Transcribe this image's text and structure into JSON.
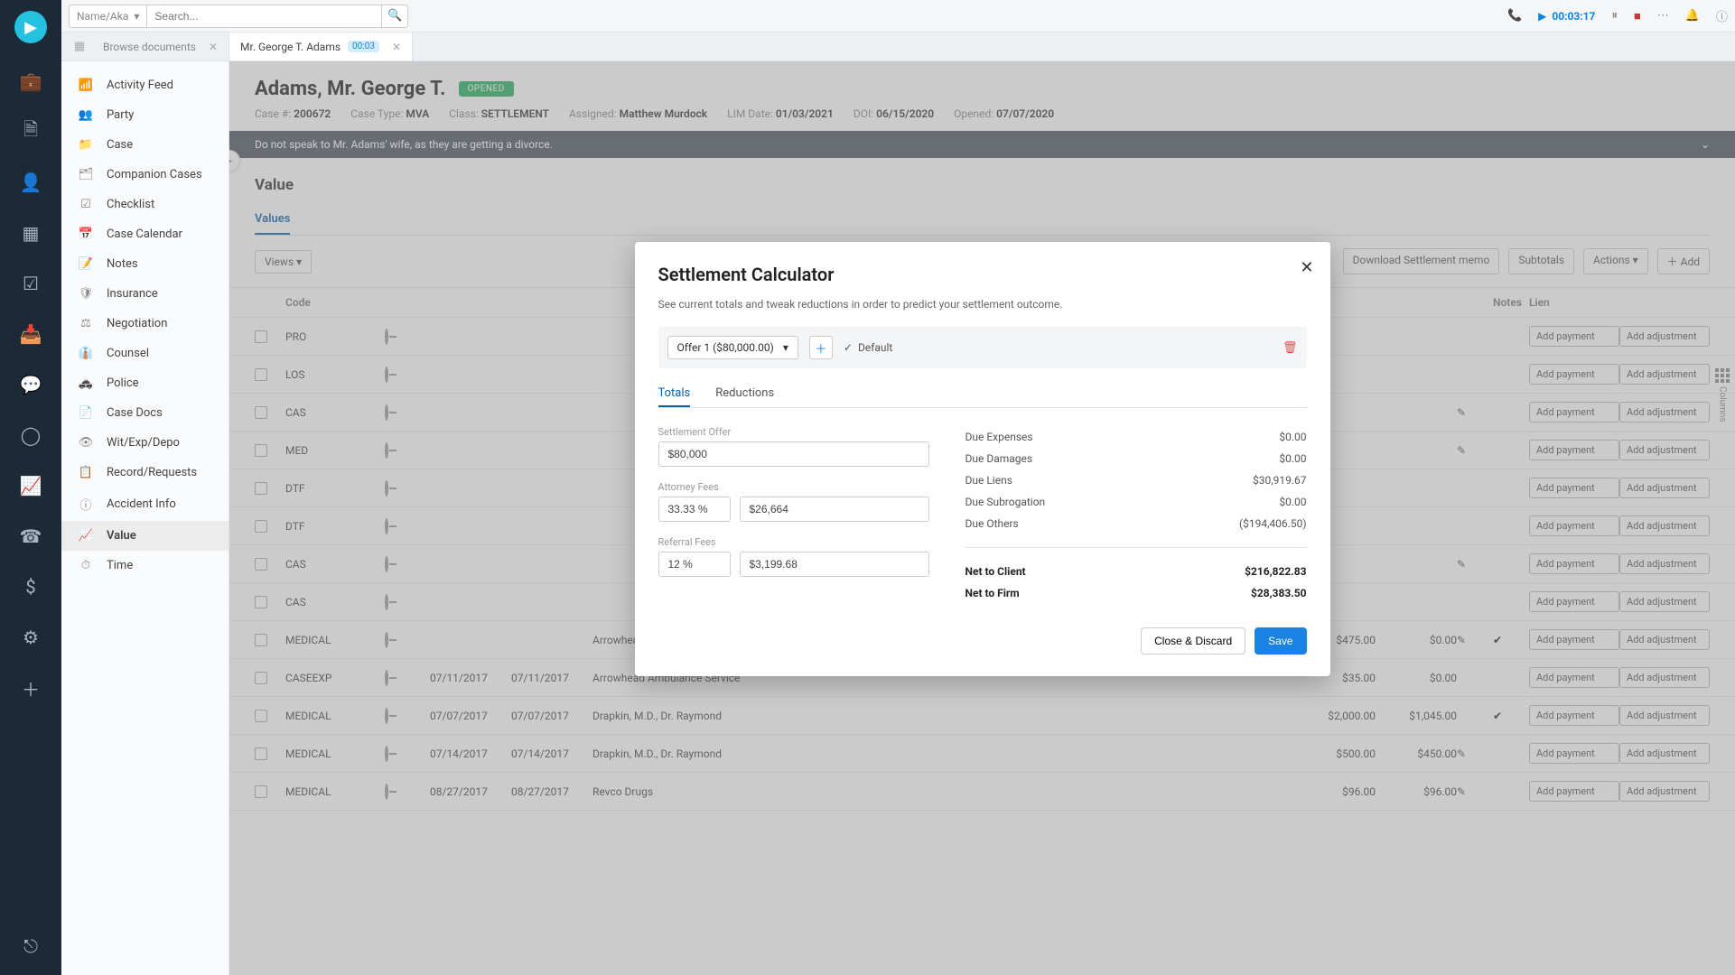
{
  "topbar": {
    "name_kind": "Name/Aka",
    "search_placeholder": "Search...",
    "timer": "00:03:17"
  },
  "tabs": {
    "browse": "Browse documents",
    "active": "Mr. George T. Adams",
    "active_badge": "00:03"
  },
  "sidenav": [
    "Activity Feed",
    "Party",
    "Case",
    "Companion Cases",
    "Checklist",
    "Case Calendar",
    "Notes",
    "Insurance",
    "Negotiation",
    "Counsel",
    "Police",
    "Case Docs",
    "Wit/Exp/Depo",
    "Record/Requests",
    "Accident Info",
    "Value",
    "Time"
  ],
  "case": {
    "name": "Adams, Mr. George T.",
    "status": "OPENED",
    "number_label": "Case #:",
    "number": "200672",
    "type_label": "Case Type:",
    "type": "MVA",
    "class_label": "Class:",
    "class": "SETTLEMENT",
    "assigned_label": "Assigned:",
    "assigned": "Matthew Murdock",
    "lim_label": "LIM Date:",
    "lim": "01/03/2021",
    "doi_label": "DOI:",
    "doi": "06/15/2020",
    "opened_label": "Opened:",
    "opened": "07/07/2020",
    "banner": "Do not speak to Mr. Adams' wife, as they are getting a divorce."
  },
  "value_section": {
    "title": "Value",
    "subtabs": [
      "Values"
    ],
    "toolbar": {
      "views": "Views",
      "dl": "Download Settlement memo",
      "subtotals": "Subtotals",
      "actions": "Actions",
      "add": "Add"
    },
    "headers": [
      "Code",
      "",
      "",
      "",
      "",
      "",
      "",
      "",
      "",
      "Notes",
      "Lien",
      "",
      ""
    ]
  },
  "rows": [
    {
      "code": "PRO",
      "d1": "",
      "d2": "",
      "payee": "",
      "amt": "",
      "amt2": "",
      "edit": false,
      "ck": false
    },
    {
      "code": "LOS",
      "d1": "",
      "d2": "",
      "payee": "",
      "amt": "",
      "amt2": "",
      "edit": false,
      "ck": false
    },
    {
      "code": "CAS",
      "d1": "",
      "d2": "",
      "payee": "",
      "amt": "",
      "amt2": "",
      "edit": true,
      "ck": false
    },
    {
      "code": "MED",
      "d1": "",
      "d2": "",
      "payee": "",
      "amt": "",
      "amt2": "",
      "edit": true,
      "ck": false
    },
    {
      "code": "DTF",
      "d1": "",
      "d2": "",
      "payee": "",
      "amt": "",
      "amt2": "",
      "edit": false,
      "ck": false
    },
    {
      "code": "DTF",
      "d1": "",
      "d2": "",
      "payee": "",
      "amt": "",
      "amt2": "",
      "edit": false,
      "ck": false
    },
    {
      "code": "CAS",
      "d1": "",
      "d2": "",
      "payee": "",
      "amt": "",
      "amt2": "",
      "edit": true,
      "ck": false
    },
    {
      "code": "CAS",
      "d1": "",
      "d2": "",
      "payee": "",
      "amt": "",
      "amt2": "",
      "edit": false,
      "ck": false
    },
    {
      "code": "MEDICAL",
      "d1": "",
      "d2": "",
      "payee": "Arrowhead Ambulance Service",
      "amt": "$475.00",
      "amt2": "$0.00",
      "edit": true,
      "ck": true
    },
    {
      "code": "CASEEXP",
      "d1": "07/11/2017",
      "d2": "07/11/2017",
      "payee": "Arrowhead Ambulance Service",
      "amt": "$35.00",
      "amt2": "$0.00",
      "edit": false,
      "ck": false
    },
    {
      "code": "MEDICAL",
      "d1": "07/07/2017",
      "d2": "07/07/2017",
      "payee": "Drapkin, M.D., Dr. Raymond",
      "amt": "$2,000.00",
      "amt2": "$1,045.00",
      "edit": false,
      "ck": true
    },
    {
      "code": "MEDICAL",
      "d1": "07/14/2017",
      "d2": "07/14/2017",
      "payee": "Drapkin, M.D., Dr. Raymond",
      "amt": "$500.00",
      "amt2": "$450.00",
      "edit": true,
      "ck": false
    },
    {
      "code": "MEDICAL",
      "d1": "08/27/2017",
      "d2": "08/27/2017",
      "payee": "Revco Drugs",
      "amt": "$96.00",
      "amt2": "$96.00",
      "edit": true,
      "ck": false
    }
  ],
  "row_buttons": {
    "pay": "Add payment",
    "adj": "Add adjustment"
  },
  "columns_label": "Columns",
  "modal": {
    "title": "Settlement Calculator",
    "sub": "See current totals and tweak reductions in order to predict your settlement outcome.",
    "offer_label": "Offer 1 ($80,000.00)",
    "default": "Default",
    "tabs": [
      "Totals",
      "Reductions"
    ],
    "fields": {
      "settlement_label": "Settlement Offer",
      "settlement": "$80,000",
      "atty_label": "Attorney Fees",
      "atty_pct": "33.33 %",
      "atty_amt": "$26,664",
      "ref_label": "Referral Fees",
      "ref_pct": "12 %",
      "ref_amt": "$3,199.68"
    },
    "lines": [
      {
        "l": "Due Expenses",
        "v": "$0.00"
      },
      {
        "l": "Due Damages",
        "v": "$0.00"
      },
      {
        "l": "Due Liens",
        "v": "$30,919.67"
      },
      {
        "l": "Due Subrogation",
        "v": "$0.00"
      },
      {
        "l": "Due Others",
        "v": "($194,406.50)"
      }
    ],
    "net_client_l": "Net to Client",
    "net_client_v": "$216,822.83",
    "net_firm_l": "Net to Firm",
    "net_firm_v": "$28,383.50",
    "close": "Close & Discard",
    "save": "Save"
  }
}
